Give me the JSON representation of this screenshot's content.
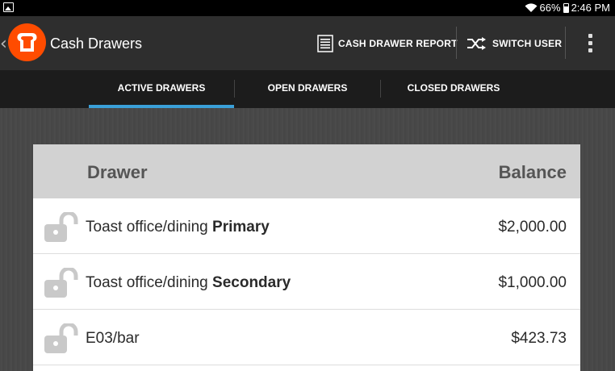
{
  "status_bar": {
    "battery": "66%",
    "time": "2:46 PM",
    "icons": [
      "image-icon",
      "wifi-icon",
      "battery-icon"
    ]
  },
  "app_bar": {
    "title": "Cash Drawers",
    "logo_color": "#FF4C00",
    "actions": {
      "report_label": "CASH DRAWER REPORT",
      "switch_label": "SWITCH USER"
    }
  },
  "tabs": [
    {
      "label": "ACTIVE DRAWERS",
      "active": true
    },
    {
      "label": "OPEN DRAWERS",
      "active": false
    },
    {
      "label": "CLOSED DRAWERS",
      "active": false
    }
  ],
  "accent_color": "#3AA0D8",
  "table": {
    "headers": {
      "drawer": "Drawer",
      "balance": "Balance"
    },
    "rows": [
      {
        "name_prefix": "Toast office/dining",
        "name_bold": "Primary",
        "balance": "$2,000.00",
        "icon": "unlocked-icon"
      },
      {
        "name_prefix": "Toast office/dining",
        "name_bold": "Secondary",
        "balance": "$1,000.00",
        "icon": "unlocked-icon"
      },
      {
        "name_prefix": "E03/bar",
        "name_bold": "",
        "balance": "$423.73",
        "icon": "unlocked-icon"
      }
    ]
  }
}
